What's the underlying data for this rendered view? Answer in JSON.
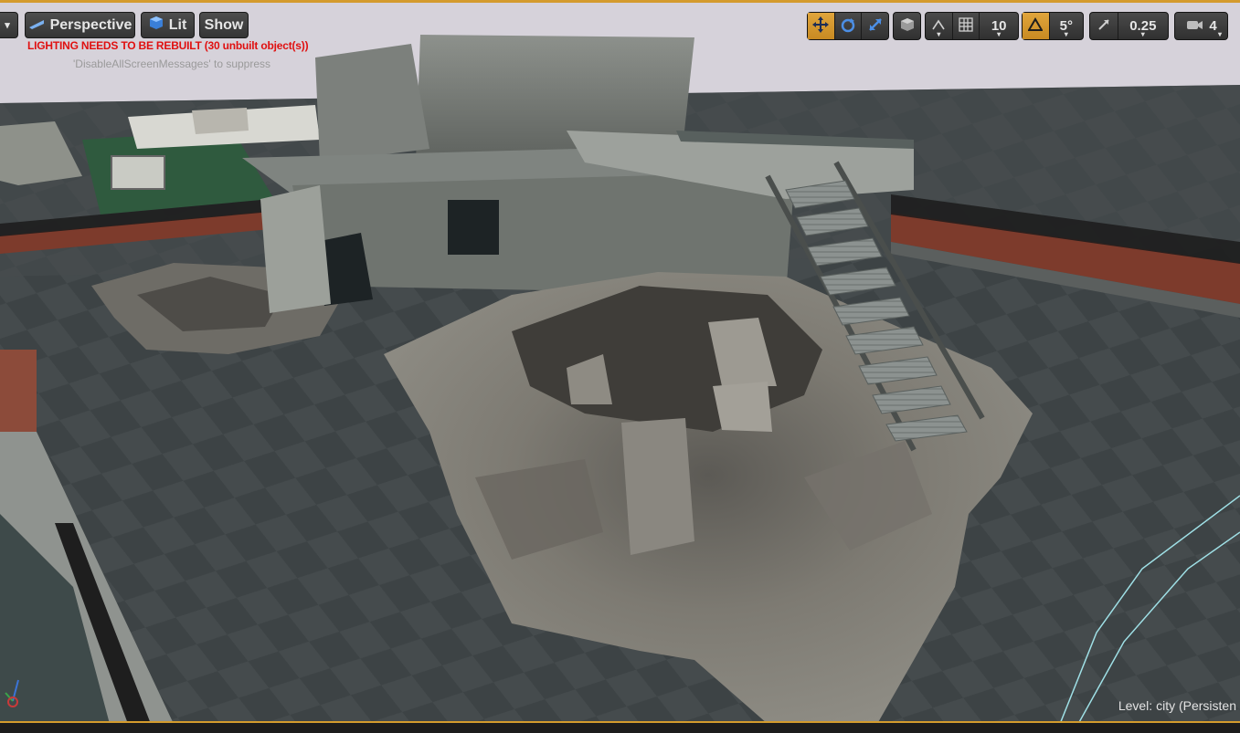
{
  "toolbar": {
    "menu_arrow": "▾",
    "perspective_label": "Perspective",
    "lit_label": "Lit",
    "show_label": "Show",
    "grid_snap_value": "10",
    "rotation_snap_value": "5°",
    "scale_snap_value": "0.25",
    "camera_speed_value": "4"
  },
  "messages": {
    "lighting_warning": "LIGHTING NEEDS TO BE REBUILT (30 unbuilt object(s))",
    "suppress_hint": "'DisableAllScreenMessages' to suppress"
  },
  "status": {
    "level_label": "Level:",
    "level_value": "city (Persisten"
  },
  "axis": {
    "z_label": "z",
    "x_label": "x"
  },
  "colors": {
    "active_orange": "#d49b2d",
    "error_red": "#e01010"
  },
  "icons": [
    "dropdown-arrow-icon",
    "perspective-icon",
    "lit-cube-icon",
    "translate-icon",
    "rotate-icon",
    "scale-icon",
    "coordinate-space-icon",
    "surface-snap-icon",
    "grid-icon",
    "rotation-snap-icon",
    "scale-snap-icon",
    "camera-speed-icon"
  ]
}
